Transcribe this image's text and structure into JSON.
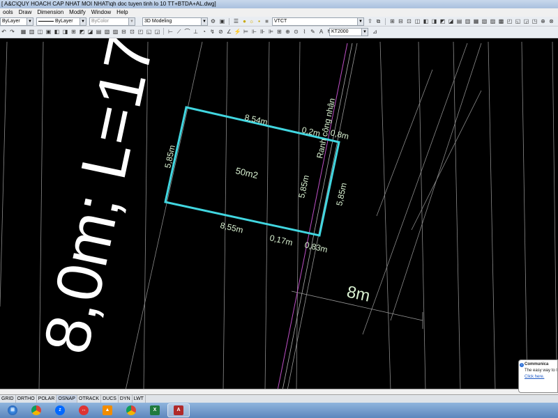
{
  "window": {
    "title": "[ A&C\\QUY HOACH CAP NHAT MOI NHAT\\qh doc tuyen tinh lo 10 TT+BTDA+AL.dwg]"
  },
  "menu": [
    "ools",
    "Draw",
    "Dimension",
    "Modify",
    "Window",
    "Help"
  ],
  "properties": {
    "layer": "ByLayer",
    "linetype": "ByLayer",
    "color": "ByColor"
  },
  "workspace": "3D Modeling",
  "layer_name": "VTCT",
  "style_name": "KT2000",
  "drawing": {
    "big_label": "8,0m; L=17",
    "boundary_label": "Ranh công nhận",
    "area": "50m2",
    "dims": {
      "top": "8,54m",
      "bottom": "8,55m",
      "left": "5,85m",
      "inner_right": "5,85m",
      "outer_right": "5,85m",
      "top_offset_a": "0,2m",
      "top_offset_b": "0,8m",
      "bottom_offset_a": "0,17m",
      "bottom_offset_b": "0,83m",
      "road_width": "8m"
    },
    "colors": {
      "background": "#000000",
      "lot_outline": "#41d6e0",
      "dim_text": "#d8f0d0",
      "grid_lines": "#8c8c8c",
      "boundary_line": "#c050c8"
    }
  },
  "status_toggles": [
    "GRID",
    "ORTHO",
    "POLAR",
    "OSNAP",
    "OTRACK",
    "DUCS",
    "DYN",
    "LWT"
  ],
  "status_active": "OSNAP",
  "taskbar": [
    "windows-start",
    "chrome",
    "zalo",
    "teamviewer",
    "vlc",
    "chrome-2",
    "excel",
    "autocad"
  ],
  "notification": {
    "title": "Communica",
    "body": "The easy way to le",
    "link": "Click here."
  }
}
